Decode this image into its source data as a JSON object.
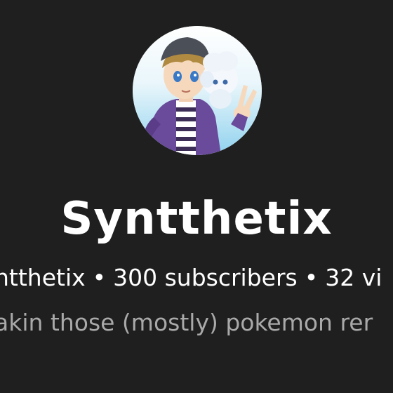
{
  "channel": {
    "name": "Syntthetix",
    "handle": "ntthetix",
    "separator": "•",
    "subscribers": "300 subscribers",
    "videos": "32 vi",
    "description": "akin those (mostly) pokemon rer"
  },
  "avatar": {
    "icon": "avatar-icon",
    "description_colors": {
      "bg_top": "#ffffff",
      "bg_bottom": "#8fd2ee",
      "jacket": "#6a4a9a",
      "hair": "#b08a40",
      "beanie": "#4b4f57"
    }
  },
  "colors": {
    "background": "#1f1f1f",
    "primary_text": "#ffffff",
    "secondary_text": "#a9a9a9"
  }
}
